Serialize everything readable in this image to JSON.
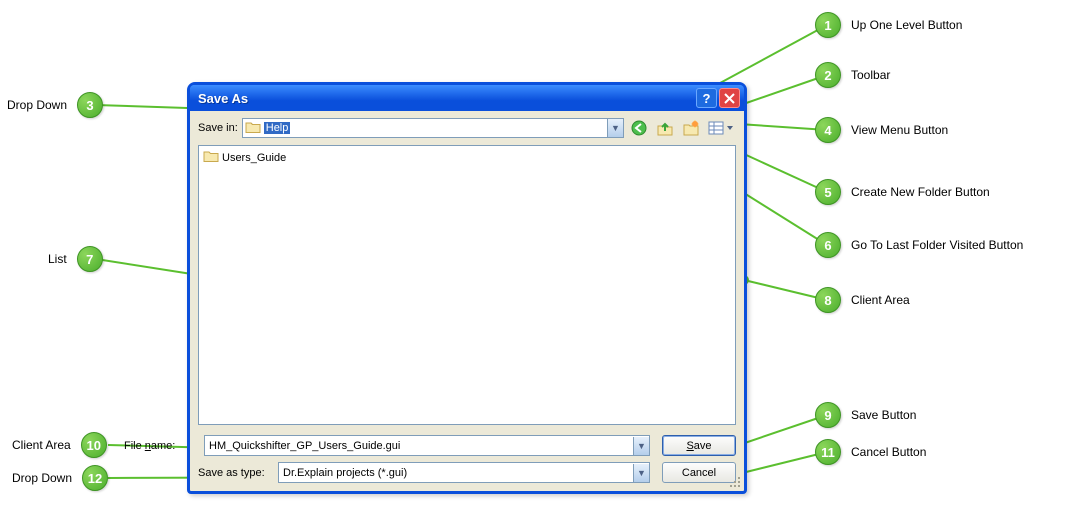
{
  "dialog": {
    "title": "Save As",
    "savein_label": "Save in:",
    "savein_value": "Help",
    "list_items": [
      "Users_Guide"
    ],
    "filename_label": "File name:",
    "filename_value": "HM_Quickshifter_GP_Users_Guide.gui",
    "saveas_label": "Save as type:",
    "saveas_value": "Dr.Explain projects (*.gui)",
    "save_button": "Save",
    "cancel_button": "Cancel"
  },
  "callouts": {
    "c1": {
      "n": "1",
      "label": "Up One Level Button"
    },
    "c2": {
      "n": "2",
      "label": "Toolbar"
    },
    "c3": {
      "n": "3",
      "label": "Drop Down"
    },
    "c4": {
      "n": "4",
      "label": "View Menu Button"
    },
    "c5": {
      "n": "5",
      "label": "Create New Folder Button"
    },
    "c6": {
      "n": "6",
      "label": "Go To Last Folder Visited Button"
    },
    "c7": {
      "n": "7",
      "label": "List"
    },
    "c8": {
      "n": "8",
      "label": "Client Area"
    },
    "c9": {
      "n": "9",
      "label": "Save Button"
    },
    "c10": {
      "n": "10",
      "label": "Client Area"
    },
    "c11": {
      "n": "11",
      "label": "Cancel Button"
    },
    "c12": {
      "n": "12",
      "label": "Drop Down"
    }
  }
}
